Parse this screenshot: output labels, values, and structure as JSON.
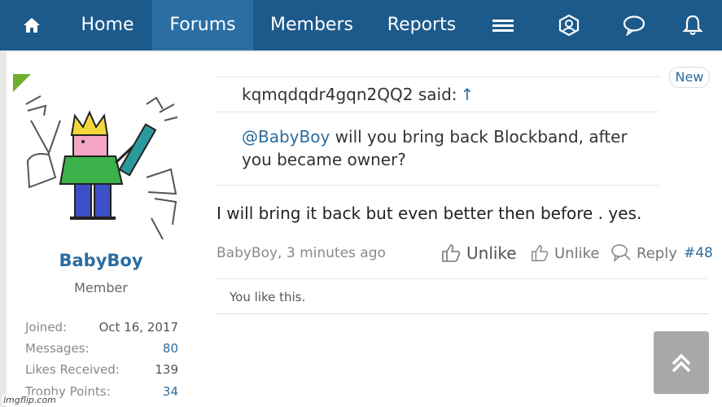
{
  "nav": {
    "home_label": "Home",
    "forums_label": "Forums",
    "members_label": "Members",
    "reports_label": "Reports",
    "icons": [
      "home-icon",
      "menu-icon",
      "user-profile-icon",
      "chat-bubble-icon",
      "bell-icon"
    ],
    "bg_color": "#1d5a8c",
    "active_bg_color": "#2a6ea3"
  },
  "user": {
    "name": "BabyBoy",
    "title": "Member",
    "stats": [
      {
        "key": "Joined:",
        "value": "Oct 16, 2017"
      },
      {
        "key": "Messages:",
        "value": "80"
      },
      {
        "key": "Likes Received:",
        "value": "139"
      },
      {
        "key": "Trophy Points:",
        "value": "34"
      }
    ]
  },
  "post": {
    "new_badge": "New",
    "quote_author": "kqmqdqdr4gqn2QQ2 said:",
    "quote_arrow": "↑",
    "quote_mention": "@BabyBoy",
    "quote_text": " will you bring back Blockband, after you became owner?",
    "message": "I will bring it back but even better then before . yes.",
    "meta": "BabyBoy, 3 minutes ago",
    "action_unlike_1": "Unlike",
    "action_unlike_2": "Unlike",
    "action_reply": "Reply",
    "post_number": "#48",
    "likes_text": "You like this."
  },
  "watermark": "imgflip.com"
}
